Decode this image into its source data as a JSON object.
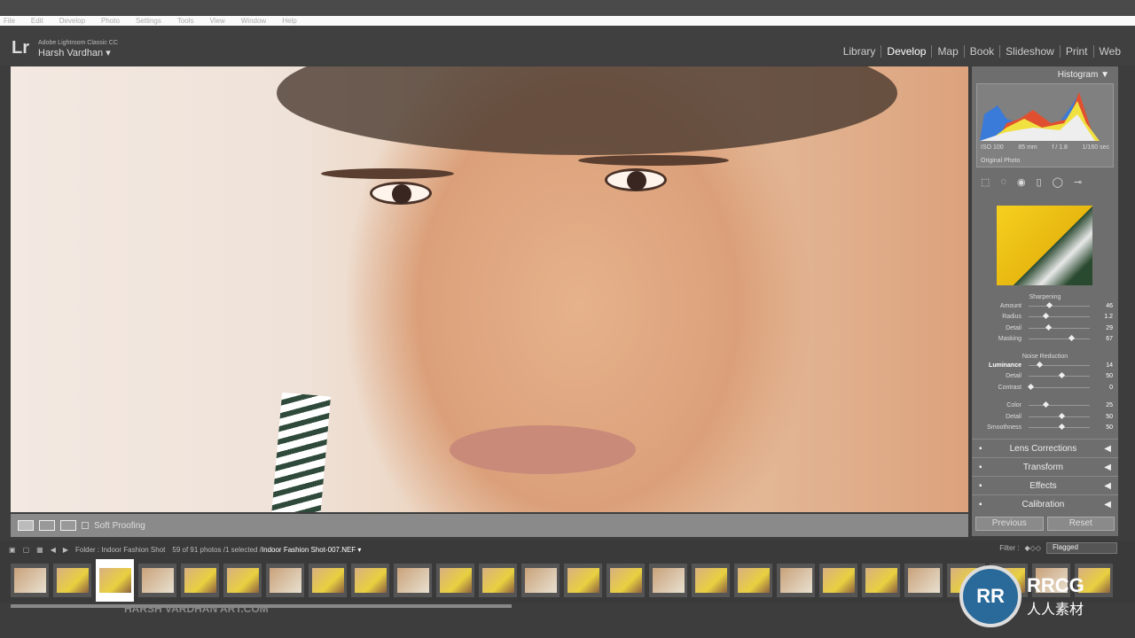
{
  "menu": [
    "File",
    "Edit",
    "Develop",
    "Photo",
    "Settings",
    "Tools",
    "View",
    "Window",
    "Help"
  ],
  "identity": {
    "logo": "Lr",
    "app": "Adobe Lightroom Classic CC",
    "user": "Harsh Vardhan ▾"
  },
  "modules": [
    "Library",
    "Develop",
    "Map",
    "Book",
    "Slideshow",
    "Print",
    "Web"
  ],
  "active_module": "Develop",
  "toolbar": {
    "soft_proofing": "Soft Proofing"
  },
  "histogram": {
    "title": "Histogram ▼",
    "iso": "ISO 100",
    "focal": "85 mm",
    "aperture": "f / 1.8",
    "shutter": "1/160 sec",
    "original": "Original Photo"
  },
  "sharpening": {
    "title": "Sharpening",
    "rows": [
      {
        "label": "Amount",
        "value": "46",
        "pct": 0.3
      },
      {
        "label": "Radius",
        "value": "1.2",
        "pct": 0.25
      },
      {
        "label": "Detail",
        "value": "29",
        "pct": 0.29
      },
      {
        "label": "Masking",
        "value": "67",
        "pct": 0.67
      }
    ]
  },
  "noise": {
    "title": "Noise Reduction",
    "rows": [
      {
        "label": "Luminance",
        "value": "14",
        "pct": 0.14
      },
      {
        "label": "Detail",
        "value": "50",
        "pct": 0.5
      },
      {
        "label": "Contrast",
        "value": "0",
        "pct": 0
      },
      {
        "label": "Color",
        "value": "25",
        "pct": 0.25
      },
      {
        "label": "Detail",
        "value": "50",
        "pct": 0.5
      },
      {
        "label": "Smoothness",
        "value": "50",
        "pct": 0.5
      }
    ]
  },
  "collapsed": [
    "Lens Corrections",
    "Transform",
    "Effects",
    "Calibration"
  ],
  "buttons": {
    "previous": "Previous",
    "reset": "Reset"
  },
  "filmbar": {
    "folder": "Folder : Indoor Fashion Shot",
    "count": "59 of 91 photos /1 selected /",
    "file": "Indoor Fashion Shot-007.NEF ▾",
    "filter_label": "Filter :",
    "filter_value": "Flagged"
  },
  "filmstrip": {
    "count": 26,
    "selected": 2
  },
  "watermark": "HARSH VARDHAN ART.COM",
  "brand": {
    "mark": "RR",
    "name": "RRCG",
    "sub": "人人素材"
  }
}
